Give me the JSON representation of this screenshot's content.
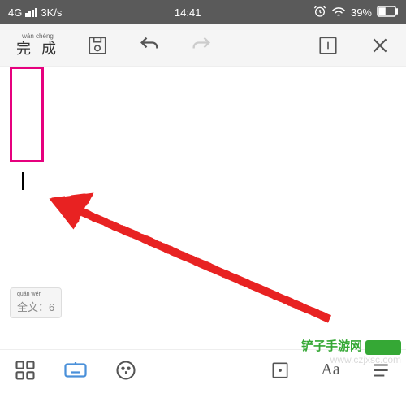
{
  "status": {
    "network_type": "4G",
    "speed": "3K/s",
    "time": "14:41",
    "battery_pct": "39%"
  },
  "toolbar": {
    "complete_pinyin": "wán chéng",
    "complete_label": "完 成"
  },
  "canvas": {
    "select_all_pinyin": "quán wén",
    "select_all_label": "全文",
    "select_all_count": "6"
  },
  "bottom": {
    "text_tool_label": "Aa"
  },
  "watermark": {
    "text": "铲子手游网",
    "url": "www.czjxsc.com"
  },
  "colors": {
    "highlight": "#e6007e",
    "arrow": "#e82020",
    "active": "#4a90d9",
    "brand": "#35a835"
  }
}
